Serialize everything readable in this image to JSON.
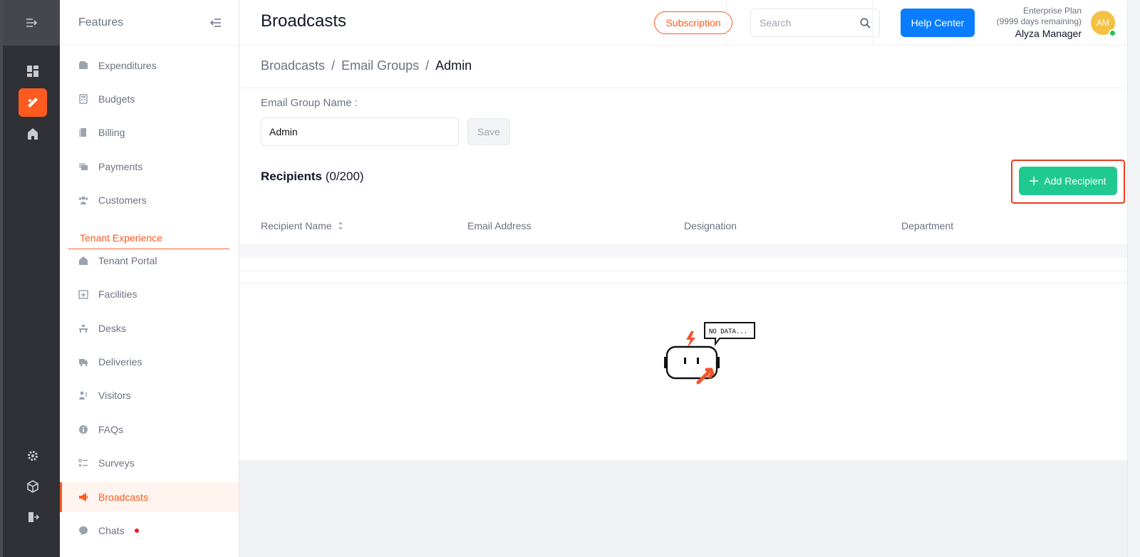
{
  "rail": {
    "icons": [
      "menu-expand-icon",
      "dashboard-icon",
      "broadcast-icon",
      "building-icon",
      "settings-icon",
      "cube-icon",
      "logout-icon"
    ]
  },
  "features": {
    "title": "Features",
    "items": [
      {
        "label": "Expenditures",
        "icon": "wallet-icon"
      },
      {
        "label": "Budgets",
        "icon": "calculator-icon"
      },
      {
        "label": "Billing",
        "icon": "billing-icon"
      },
      {
        "label": "Payments",
        "icon": "payments-icon"
      },
      {
        "label": "Customers",
        "icon": "customers-icon"
      }
    ],
    "section": "Tenant Experience",
    "tenant_items": [
      {
        "label": "Tenant Portal",
        "icon": "home-icon"
      },
      {
        "label": "Facilities",
        "icon": "calendar-plus-icon"
      },
      {
        "label": "Desks",
        "icon": "desk-icon"
      },
      {
        "label": "Deliveries",
        "icon": "truck-icon"
      },
      {
        "label": "Visitors",
        "icon": "visitor-icon"
      },
      {
        "label": "FAQs",
        "icon": "info-icon"
      },
      {
        "label": "Surveys",
        "icon": "survey-icon"
      },
      {
        "label": "Broadcasts",
        "icon": "megaphone-icon"
      },
      {
        "label": "Chats",
        "icon": "chat-icon"
      }
    ]
  },
  "header": {
    "title": "Broadcasts",
    "subscription": "Subscription",
    "search_placeholder": "Search",
    "help": "Help Center",
    "plan": "Enterprise Plan",
    "days": "(9999 days remaining)",
    "user": "Alyza Manager",
    "initials": "AM"
  },
  "main": {
    "breadcrumb": [
      "Broadcasts",
      "Email Groups",
      "Admin"
    ],
    "group_label": "Email Group Name",
    "group_value": "Admin",
    "save": "Save",
    "recipients_title": "Recipients",
    "recipients_count": "(0/200)",
    "add_recipient": "Add Recipient",
    "columns": [
      "Recipient Name",
      "Email Address",
      "Designation",
      "Department"
    ],
    "empty_text": "NO DATA..."
  },
  "colors": {
    "accent": "#ff5a1f",
    "primary": "#0a7cff",
    "success": "#20c98f"
  }
}
